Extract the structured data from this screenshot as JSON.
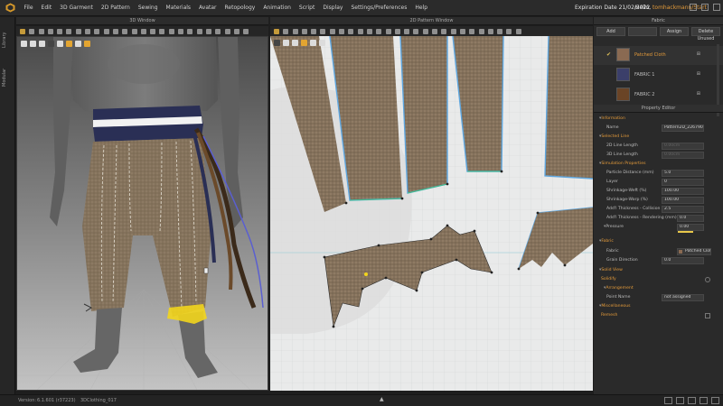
{
  "menubar": {
    "items": [
      "File",
      "Edit",
      "3D Garment",
      "2D Pattern",
      "Sewing",
      "Materials",
      "Avatar",
      "Retopology",
      "Animation",
      "Script",
      "Display",
      "Settings/Preferences",
      "Help"
    ],
    "expiration": "Expiration Date 21/02/2022",
    "hello_prefix": "Hello,",
    "user": "tomhackmann/Start"
  },
  "rail": {
    "tabs": [
      "Library",
      "Modular"
    ]
  },
  "windows": {
    "w3d_title": "3D Window",
    "pattern_title": "2D Pattern Window"
  },
  "fabric": {
    "title": "Fabric",
    "buttons": [
      "Add",
      "",
      "Assign",
      "Delete Unused"
    ],
    "items": [
      {
        "name": "Patched Cloth",
        "active": true,
        "color": "#8a6a52"
      },
      {
        "name": "FABRIC 1",
        "active": false,
        "color": "#3b3f6a"
      },
      {
        "name": "FABRIC 2",
        "active": false,
        "color": "#6a4426"
      }
    ]
  },
  "property_editor": {
    "title": "Property Editor",
    "information": "Information",
    "name_label": "Name",
    "name_value": "Pattern2D_226790",
    "selected_line": "Selected Line",
    "line2d_label": "2D Line Length",
    "line2d_value": "0.00cm",
    "line3d_label": "3D Line Length",
    "line3d_value": "0.00cm",
    "simulation": "Simulation Properties",
    "particle_label": "Particle Distance (mm)",
    "particle_value": "5.0",
    "layer_label": "Layer",
    "layer_value": "0",
    "weft_label": "Shrinkage-Weft (%)",
    "weft_value": "100.00",
    "warp_label": "Shrinkage-Warp (%)",
    "warp_value": "100.00",
    "collision_label": "Add'l Thickness - Collision (mm)",
    "collision_value": "2.5",
    "rendering_label": "Add'l Thickness - Rendering (mm)",
    "rendering_value": "0.0",
    "pressure_label": "Pressure",
    "pressure_value": "0.00",
    "fabric_section": "Fabric",
    "fabric_label": "Fabric",
    "fabric_value": "Patched Cloth",
    "grain_label": "Grain Direction",
    "grain_value": "0.0",
    "solid_view": "Solid View",
    "solidify": "Solidify",
    "arrangement": "Arrangement",
    "point_label": "Point Name",
    "point_value": "not assigned",
    "misc": "Miscellaneous",
    "remesh": "Remesh"
  },
  "status": {
    "version_label": "Version:",
    "version": "6.1.601 (r37223)",
    "file": "3DClothing_017"
  },
  "colors": {
    "accent": "#e39a3a",
    "selection_blue": "#5fa7e0",
    "highlight_yellow": "#f2d51c"
  }
}
